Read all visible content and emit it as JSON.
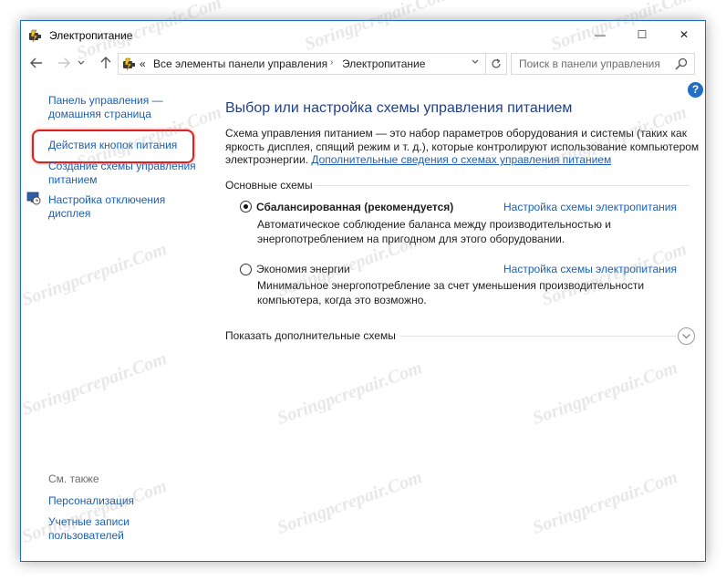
{
  "window": {
    "title": "Электропитание",
    "controls": {
      "minimize": "—",
      "maximize": "☐",
      "close": "✕"
    }
  },
  "navbar": {
    "overflow": "«",
    "breadcrumb": [
      "Все элементы панели управления",
      "Электропитание"
    ],
    "breadcrumb_sep": "›",
    "search_placeholder": "Поиск в панели управления"
  },
  "sidebar": {
    "home_link_line1": "Панель управления —",
    "home_link_line2": "домашняя страница",
    "items": [
      {
        "label": "Действия кнопок питания",
        "highlighted": true
      },
      {
        "label_line1": "Создание схемы управления",
        "label_line2": "питанием"
      },
      {
        "label_line1": "Настройка отключения",
        "label_line2": "дисплея",
        "icon": "display-clock-icon"
      }
    ],
    "see_also_label": "См. также",
    "see_also": [
      {
        "label": "Персонализация"
      },
      {
        "label_line1": "Учетные записи",
        "label_line2": "пользователей"
      }
    ]
  },
  "main": {
    "title": "Выбор или настройка схемы управления питанием",
    "description": "Схема управления питанием — это набор параметров оборудования и системы (таких как яркость дисплея, спящий режим и т. д.), которые контролируют использование компьютером электроэнергии.",
    "description_link": "Дополнительные сведения о схемах управления питанием",
    "section_label": "Основные схемы",
    "plans": [
      {
        "name": "Сбалансированная (рекомендуется)",
        "selected": true,
        "description": "Автоматическое соблюдение баланса между производительностью и энергопотреблением на пригодном для этого оборудовании.",
        "link": "Настройка схемы электропитания"
      },
      {
        "name": "Экономия энергии",
        "selected": false,
        "description": "Минимальное энергопотребление за счет уменьшения производительности компьютера, когда это возможно.",
        "link": "Настройка схемы электропитания"
      }
    ],
    "show_more": "Показать дополнительные схемы"
  },
  "watermark": "Soringpcrepair.Com",
  "colors": {
    "link": "#1b5fb2",
    "title": "#1f3f8f",
    "highlight": "#e01e1e",
    "window_border": "#1e6fb8"
  }
}
